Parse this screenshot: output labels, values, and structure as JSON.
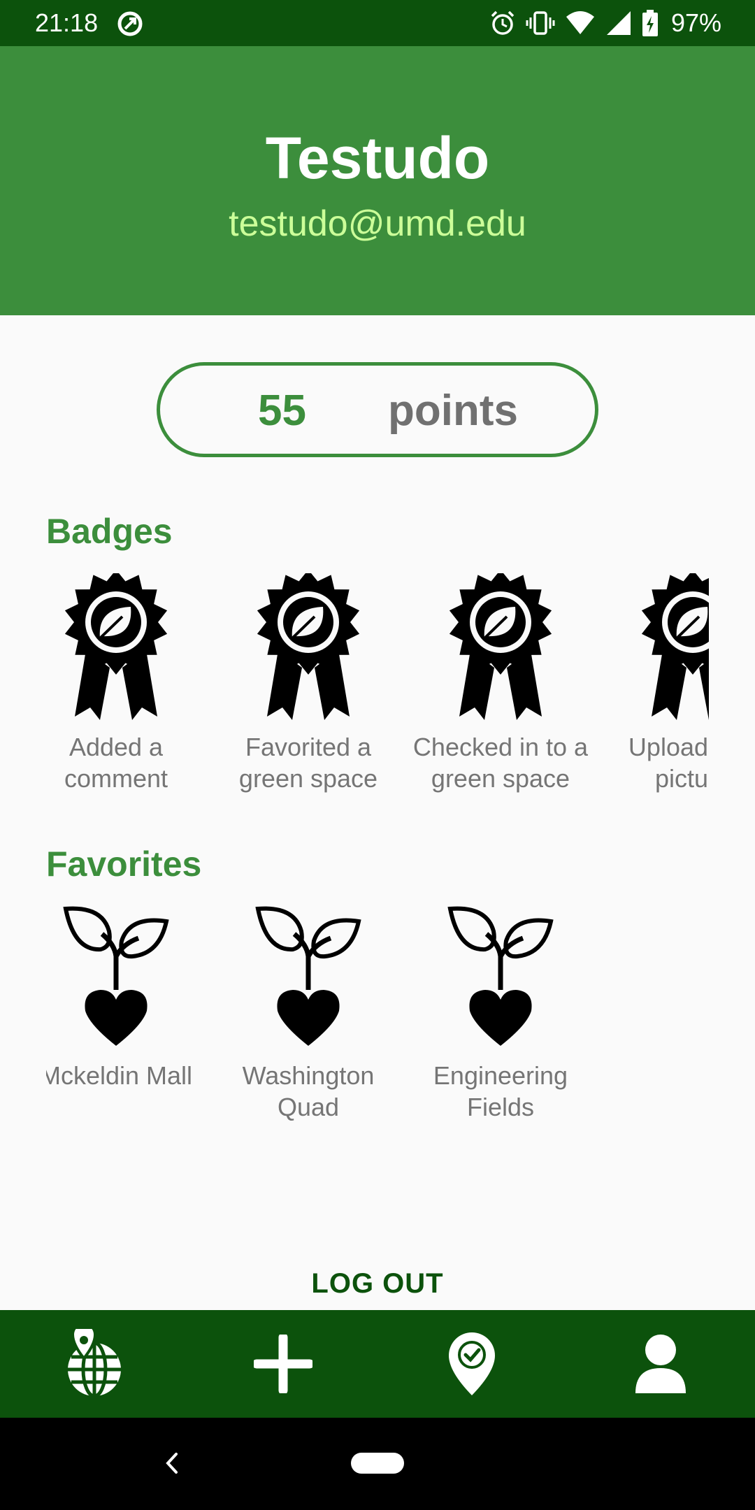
{
  "status_bar": {
    "time": "21:18",
    "battery_percent": "97%",
    "icons": [
      "data-saver-icon",
      "alarm-icon",
      "vibrate-icon",
      "wifi-icon",
      "cell-signal-icon",
      "battery-charging-icon"
    ]
  },
  "profile": {
    "name": "Testudo",
    "email": "testudo@umd.edu"
  },
  "points": {
    "value": "55",
    "label": "points"
  },
  "badges": {
    "title": "Badges",
    "items": [
      {
        "line1": "Added a",
        "line2": "comment",
        "icon": "award-leaf-icon"
      },
      {
        "line1": "Favorited a",
        "line2": "green space",
        "icon": "award-leaf-icon"
      },
      {
        "line1": "Checked in to a",
        "line2": "green space",
        "icon": "award-leaf-icon"
      },
      {
        "line1": "Uploaded a",
        "line2": "picture",
        "icon": "award-leaf-icon"
      }
    ]
  },
  "favorites": {
    "title": "Favorites",
    "items": [
      {
        "line1": "Mckeldin Mall",
        "line2": "",
        "icon": "sprout-heart-icon"
      },
      {
        "line1": "Washington",
        "line2": "Quad",
        "icon": "sprout-heart-icon"
      },
      {
        "line1": "Engineering",
        "line2": "Fields",
        "icon": "sprout-heart-icon"
      }
    ]
  },
  "logout": {
    "label": "LOG OUT"
  },
  "bottom_nav": {
    "items": [
      {
        "name": "map",
        "icon": "globe-pin-icon"
      },
      {
        "name": "add",
        "icon": "plus-icon"
      },
      {
        "name": "check-in",
        "icon": "location-check-icon"
      },
      {
        "name": "profile",
        "icon": "person-icon"
      }
    ]
  },
  "colors": {
    "status_bar": "#0c520c",
    "header": "#3c8e3c",
    "accent": "#3c8e3c",
    "email": "#ccff99",
    "label_gray": "#757575",
    "bottom_nav": "#0c520c"
  }
}
